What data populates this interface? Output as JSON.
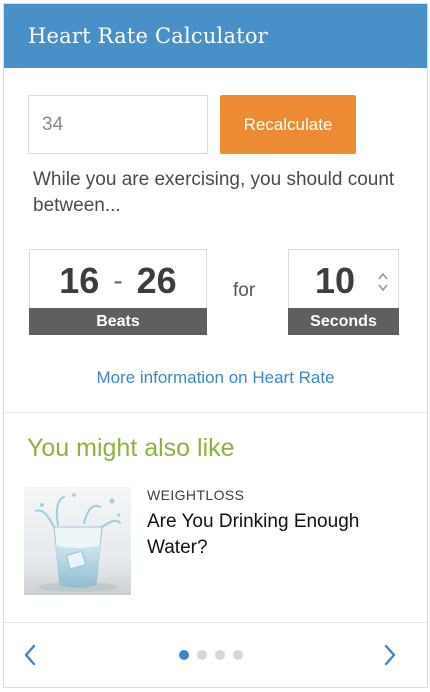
{
  "header": {
    "title": "Heart Rate Calculator"
  },
  "calculator": {
    "age_placeholder": "34",
    "recalculate_label": "Recalculate",
    "instruction": "While you are exercising, you should count between...",
    "beats_low": "16",
    "separator": "-",
    "beats_high": "26",
    "beats_label": "Beats",
    "for_text": "for",
    "seconds_value": "10",
    "seconds_label": "Seconds",
    "more_info_link": "More information on Heart Rate"
  },
  "related": {
    "heading": "You might also like",
    "article": {
      "category": "WEIGHTLOSS",
      "title": "Are You Drinking Enough Water?",
      "thumbnail_icon": "glass-of-water-image"
    }
  },
  "pager": {
    "prev_icon": "chevron-left-icon",
    "next_icon": "chevron-right-icon",
    "page_count": 4,
    "active_page": 1
  },
  "colors": {
    "header_bg": "#4a90c8",
    "button_bg": "#ed8b34",
    "link": "#3d87c4",
    "heading_green": "#8eb13f",
    "label_bar": "#5f5f5f"
  }
}
